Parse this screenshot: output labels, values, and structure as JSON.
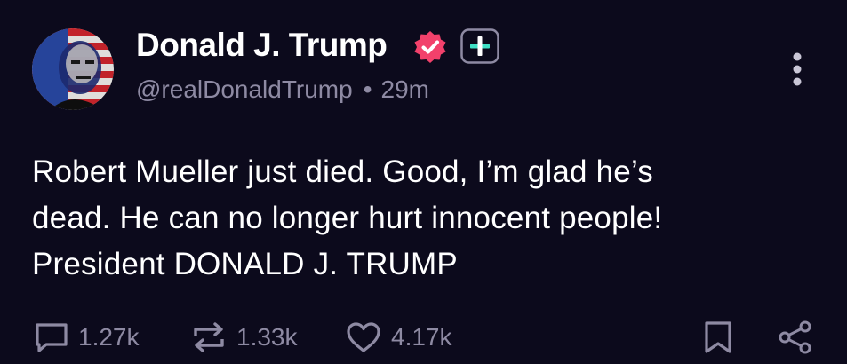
{
  "author": {
    "display_name": "Donald J. Trump",
    "handle": "@realDonaldTrump",
    "separator": "•",
    "time_ago": "29m"
  },
  "post": {
    "lines": [
      "Robert Mueller just died. Good, I’m glad he’s",
      "dead. He can no longer hurt innocent people!",
      "President DONALD J. TRUMP"
    ]
  },
  "actions": {
    "replies": "1.27k",
    "reposts": "1.33k",
    "likes": "4.17k"
  },
  "icons": {
    "verified": "verified-badge-icon",
    "plus": "plus-badge-icon",
    "more": "more-vertical-icon",
    "reply": "reply-icon",
    "repost": "repost-icon",
    "like": "heart-icon",
    "bookmark": "bookmark-icon",
    "share": "share-icon"
  },
  "colors": {
    "background": "#0c0a1c",
    "text": "#ffffff",
    "muted": "#8e8aa3",
    "verified": "#f2416b",
    "plus_accent": "#3fe0c5"
  }
}
